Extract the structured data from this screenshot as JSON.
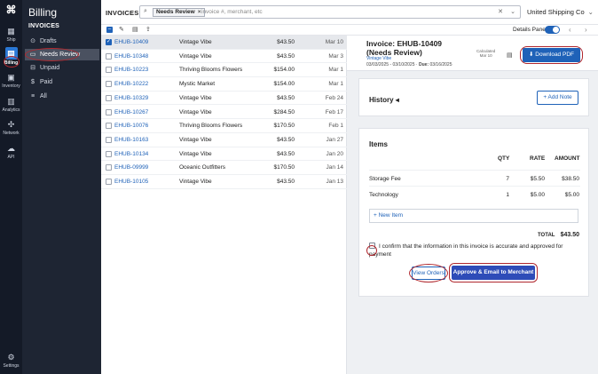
{
  "rail": {
    "items": [
      {
        "label": "Ship",
        "icon": "truck-icon"
      },
      {
        "label": "Billing",
        "icon": "billing-icon"
      },
      {
        "label": "Inventory",
        "icon": "inventory-icon"
      },
      {
        "label": "Analytics",
        "icon": "analytics-icon"
      },
      {
        "label": "Network",
        "icon": "network-icon"
      },
      {
        "label": "API",
        "icon": "cloud-icon"
      },
      {
        "label": "Settings",
        "icon": "gear-icon"
      }
    ]
  },
  "sidebar": {
    "title": "Billing",
    "section": "INVOICES",
    "items": [
      {
        "label": "Drafts",
        "icon": "draft-icon"
      },
      {
        "label": "Needs Review",
        "icon": "review-icon"
      },
      {
        "label": "Unpaid",
        "icon": "unpaid-icon"
      },
      {
        "label": "Paid",
        "icon": "dollar-icon"
      },
      {
        "label": "All",
        "icon": "all-icon"
      }
    ]
  },
  "topbar": {
    "label": "INVOICES",
    "chip": "Needs Review",
    "search_placeholder": "invoice #, merchant, etc",
    "company": "United Shipping Co"
  },
  "toolbar": {
    "details_pane_label": "Details Pane"
  },
  "invoices": [
    {
      "id": "EHUB-10409",
      "merchant": "Vintage Vibe",
      "amount": "$43.50",
      "date": "Mar 10",
      "selected": true
    },
    {
      "id": "EHUB-10348",
      "merchant": "Vintage Vibe",
      "amount": "$43.50",
      "date": "Mar 3",
      "selected": false
    },
    {
      "id": "EHUB-10223",
      "merchant": "Thriving Blooms Flowers",
      "amount": "$154.00",
      "date": "Mar 1",
      "selected": false
    },
    {
      "id": "EHUB-10222",
      "merchant": "Mystic Market",
      "amount": "$154.00",
      "date": "Mar 1",
      "selected": false
    },
    {
      "id": "EHUB-10329",
      "merchant": "Vintage Vibe",
      "amount": "$43.50",
      "date": "Feb 24",
      "selected": false
    },
    {
      "id": "EHUB-10267",
      "merchant": "Vintage Vibe",
      "amount": "$284.50",
      "date": "Feb 17",
      "selected": false
    },
    {
      "id": "EHUB-10076",
      "merchant": "Thriving Blooms Flowers",
      "amount": "$170.50",
      "date": "Feb 1",
      "selected": false
    },
    {
      "id": "EHUB-10163",
      "merchant": "Vintage Vibe",
      "amount": "$43.50",
      "date": "Jan 27",
      "selected": false
    },
    {
      "id": "EHUB-10134",
      "merchant": "Vintage Vibe",
      "amount": "$43.50",
      "date": "Jan 20",
      "selected": false
    },
    {
      "id": "EHUB-09999",
      "merchant": "Oceanic Outfitters",
      "amount": "$170.50",
      "date": "Jan 14",
      "selected": false
    },
    {
      "id": "EHUB-10105",
      "merchant": "Vintage Vibe",
      "amount": "$43.50",
      "date": "Jan 13",
      "selected": false
    }
  ],
  "detail": {
    "title": "Invoice: EHUB-10409 (Needs Review)",
    "merchant": "Vintage Vibe",
    "date_range": "03/03/2025 - 03/10/2025",
    "due_label": "Due:",
    "due_date": "03/16/2025",
    "calculated_label": "Calculated",
    "calculated_date": "Mar 10",
    "download_label": "Download PDF",
    "history_label": "History",
    "add_note_label": "+ Add Note",
    "items_label": "Items",
    "columns": {
      "qty": "QTY",
      "rate": "RATE",
      "amount": "AMOUNT"
    },
    "line_items": [
      {
        "name": "Storage Fee",
        "qty": "7",
        "rate": "$5.50",
        "amount": "$38.50"
      },
      {
        "name": "Technology",
        "qty": "1",
        "rate": "$5.00",
        "amount": "$5.00"
      }
    ],
    "new_item_label": "+ New Item",
    "total_label": "TOTAL",
    "total_value": "$43.50",
    "confirm_text": "I confirm that the information in this invoice is accurate and approved for payment",
    "view_orders_label": "View Orders",
    "approve_label": "Approve & Email to Merchant"
  },
  "colors": {
    "accent": "#1f62b8",
    "rail_bg": "#141a27",
    "sidebar_bg": "#1e2533",
    "annotation_ring": "#b0282e"
  }
}
